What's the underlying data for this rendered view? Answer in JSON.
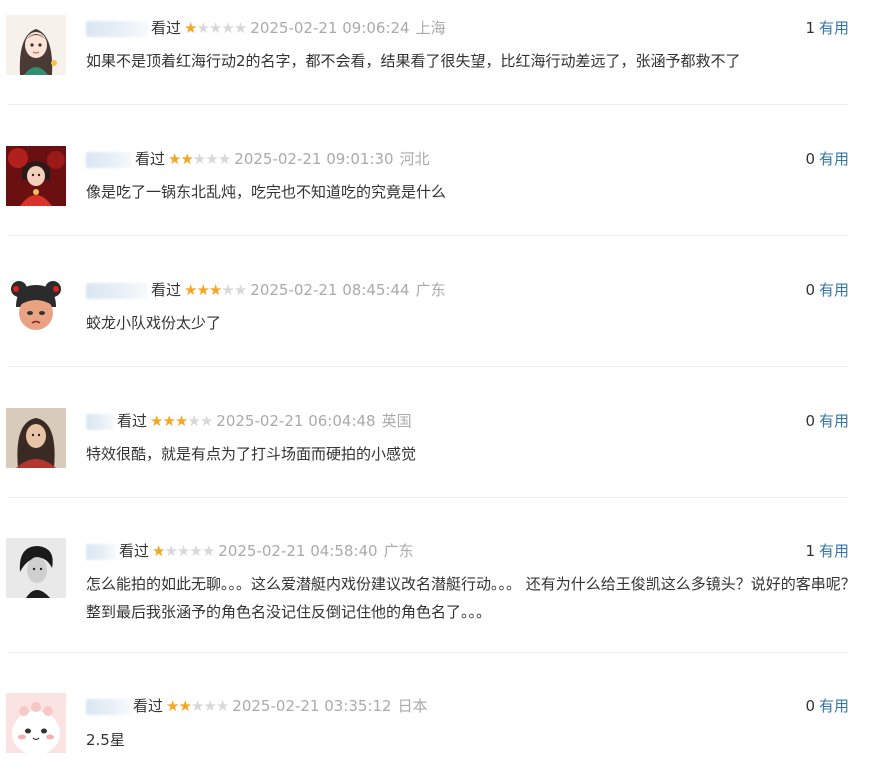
{
  "reviews": [
    {
      "status": "看过",
      "rating": 1,
      "time": "2025-02-21 09:06:24",
      "location": "上海",
      "useful_count": "1",
      "useful_label": "有用",
      "content": "如果不是顶着红海行动2的名字，都不会看，结果看了很失望，比红海行动差远了，张涵予都救不了",
      "avatar": "cartoon-girl"
    },
    {
      "status": "看过",
      "rating": 2,
      "time": "2025-02-21 09:01:30",
      "location": "河北",
      "useful_count": "0",
      "useful_label": "有用",
      "content": "像是吃了一锅东北乱炖，吃完也不知道吃的究竟是什么",
      "avatar": "child-red-dress"
    },
    {
      "status": "看过",
      "rating": 3,
      "time": "2025-02-21 08:45:44",
      "location": "广东",
      "useful_count": "0",
      "useful_label": "有用",
      "content": "蛟龙小队戏份太少了",
      "avatar": "cartoon-child-buns"
    },
    {
      "status": "看过",
      "rating": 3,
      "time": "2025-02-21 06:04:48",
      "location": "英国",
      "useful_count": "0",
      "useful_label": "有用",
      "content": "特效很酷，就是有点为了打斗场面而硬拍的小感觉",
      "avatar": "woman-long-hair"
    },
    {
      "status": "看过",
      "rating": 1,
      "time": "2025-02-21 04:58:40",
      "location": "广东",
      "useful_count": "1",
      "useful_label": "有用",
      "content": "怎么能拍的如此无聊。。。这么爱潜艇内戏份建议改名潜艇行动。。。 还有为什么给王俊凯这么多镜头？说好的客串呢？整到最后我张涵予的角色名没记住反倒记住他的角色名了。。。",
      "avatar": "man-black-white"
    },
    {
      "status": "看过",
      "rating": 2,
      "time": "2025-02-21 03:35:12",
      "location": "日本",
      "useful_count": "0",
      "useful_label": "有用",
      "content": "2.5星",
      "avatar": "pink-blob"
    }
  ]
}
